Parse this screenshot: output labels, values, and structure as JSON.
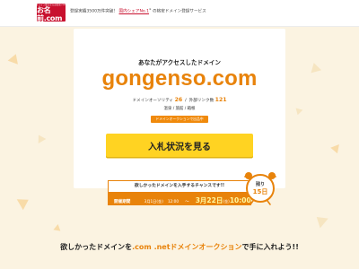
{
  "header": {
    "logo_small": "ドメイン取るならお名前.com",
    "logo_main": "お名前.com",
    "tagline_pre": "登録実績3500万件突破！",
    "tagline_link": "国内シェアNo.1",
    "tagline_sup": "※",
    "tagline_post": "の格安ドメイン登録サービス"
  },
  "card": {
    "subtitle": "あなたがアクセスしたドメイン",
    "domain": "gongenso.com",
    "authority_label": "ドメインオーソリティ",
    "authority_value": "26",
    "links_label": "外部リンク数",
    "links_value": "121",
    "categories": "温泉 / 旅館 / 箱根",
    "pill_label": "ドメインオークションで出品中",
    "bid_button": "入札状況を見る"
  },
  "banner": {
    "headline": "欲しかったドメインを入手するチャンスです!!",
    "period_label": "開催期間",
    "start_date": "3月1日",
    "start_day": "(金)",
    "start_time": "12:00",
    "arrow": "〜",
    "end_date": "3月22日",
    "end_day": "(金)",
    "end_time": "10:00",
    "end_suffix": "まで",
    "clock_top": "残り",
    "clock_days": "15日"
  },
  "footer": {
    "pre": "欲しかったドメインを",
    "com": ".com",
    "net": ".net",
    "auction": "ドメインオークション",
    "post": "で手に入れよう!!"
  },
  "colors": {
    "accent": "#e8830b",
    "brand_red": "#c8102e",
    "button_yellow": "#ffd322",
    "background": "#fbf3e1"
  },
  "icons": [
    "alarm-clock-icon"
  ]
}
